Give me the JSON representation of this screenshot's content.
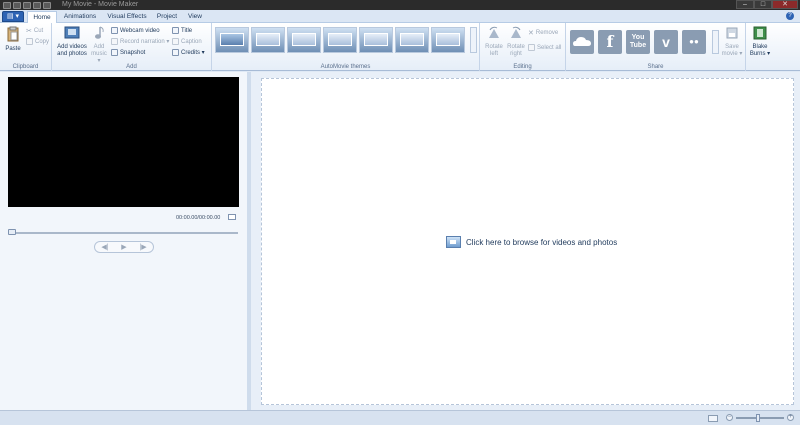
{
  "window": {
    "title": "My Movie - Movie Maker",
    "app_menu_label": "▤ ▾",
    "buttons": {
      "minimize": "–",
      "maximize": "□",
      "close": "✕"
    }
  },
  "tabs": [
    "Home",
    "Animations",
    "Visual Effects",
    "Project",
    "View"
  ],
  "active_tab": "Home",
  "ribbon": {
    "clipboard": {
      "label": "Clipboard",
      "paste": "Paste",
      "cut": "Cut",
      "copy": "Copy"
    },
    "add": {
      "label": "Add",
      "add_videos_photos_line1": "Add videos",
      "add_videos_photos_line2": "and photos",
      "add_music_line1": "Add",
      "add_music_line2": "music ▾",
      "webcam_video": "Webcam video",
      "record_narration": "Record narration ▾",
      "snapshot": "Snapshot",
      "title": "Title",
      "caption": "Caption",
      "credits": "Credits ▾"
    },
    "automovie": {
      "label": "AutoMovie themes"
    },
    "editing": {
      "label": "Editing",
      "rotate_left_line1": "Rotate",
      "rotate_left_line2": "left",
      "rotate_right_line1": "Rotate",
      "rotate_right_line2": "right",
      "remove": "Remove",
      "select_all": "Select all"
    },
    "share": {
      "label": "Share",
      "youtube_line1": "You",
      "youtube_line2": "Tube",
      "facebook": "f",
      "vimeo": "v",
      "flickr": "●●",
      "save_movie_line1": "Save",
      "save_movie_line2": "movie ▾",
      "user_line1": "Blake",
      "user_line2": "Burns ▾"
    }
  },
  "preview": {
    "timecode": "00:00.00/00:00.00"
  },
  "playback": {
    "prev": "◀|",
    "play": "▶",
    "next": "|▶"
  },
  "storyboard": {
    "browse_text": "Click here to browse for videos and photos"
  },
  "status": {
    "zoom_out": "−",
    "zoom_in": "+"
  },
  "colors": {
    "ribbon_bg": "#ffffff",
    "chrome_bg": "#dfe9f5",
    "preview_bg": "#000000",
    "accent": "#2d63b4"
  }
}
